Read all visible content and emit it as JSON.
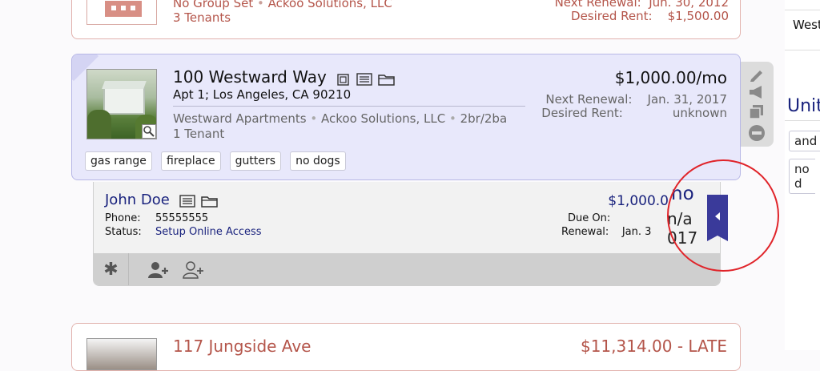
{
  "prev_card": {
    "group": "No Group Set",
    "company": "Ackoo Solutions, LLC",
    "tenants": "3 Tenants",
    "renewal_label": "Next Renewal:",
    "renewal_value": "Jun. 30, 2012",
    "desired_label": "Desired Rent:",
    "desired_value": "$1,500.00"
  },
  "unit": {
    "title": "100 Westward Way",
    "address": "Apt 1; Los Angeles, CA 90210",
    "rent": "$1,000.00/mo",
    "renewal_label": "Next Renewal:",
    "renewal_value": "Jan. 31, 2017",
    "desired_label": "Desired Rent:",
    "desired_value": "unknown",
    "complex": "Westward Apartments",
    "company": "Ackoo Solutions, LLC",
    "beds": "2br/2ba",
    "tenants": "1 Tenant",
    "tags": [
      "gas range",
      "fireplace",
      "gutters",
      "no dogs"
    ]
  },
  "tenant": {
    "name": "John Doe",
    "phone_label": "Phone:",
    "phone": "55555555",
    "status_label": "Status:",
    "status": "Setup Online Access",
    "rent": "$1,000.0",
    "due_label": "Due On:",
    "renewal_label": "Renewal:",
    "renewal_value": "Jan. 3",
    "overlay_no": "no",
    "overlay_na": "n/a",
    "overlay_year": "017"
  },
  "next_card": {
    "title": "117 Jungside Ave",
    "rent": "$11,314.00 - LATE"
  },
  "right_panel": {
    "top_label": "West",
    "heading": "Unit",
    "chip1": "and",
    "chip2": "no d"
  },
  "colors": {
    "accent_red": "#b4554a",
    "selected_bg": "#e8e8fb",
    "navy": "#1a237e",
    "tab_blue": "#3a3a9a"
  }
}
